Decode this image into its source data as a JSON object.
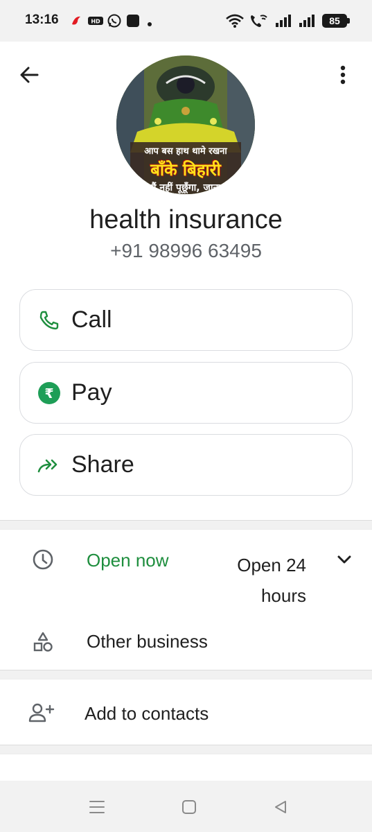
{
  "status_bar": {
    "time": "13:16",
    "battery": "85"
  },
  "contact": {
    "name": "health insurance",
    "phone": "+91 98996 63495",
    "avatar_text": {
      "line1": "आप बस हाथ थामे रखना",
      "line2": "बाँके बिहारी",
      "line3": "मैं नहीं पूछूँगा, जाना"
    }
  },
  "actions": [
    {
      "label": "Call",
      "icon": "phone-icon"
    },
    {
      "label": "Pay",
      "icon": "rupee-icon"
    },
    {
      "label": "Share",
      "icon": "share-icon"
    }
  ],
  "details": {
    "hours_status": "Open now",
    "hours_value": "Open 24 hours",
    "category": "Other business",
    "add_contacts": "Add to contacts"
  },
  "colors": {
    "accent_green": "#1e8e3e",
    "pay_green": "#1e9e57",
    "text_primary": "#1f1f1f",
    "text_secondary": "#5f6368"
  }
}
